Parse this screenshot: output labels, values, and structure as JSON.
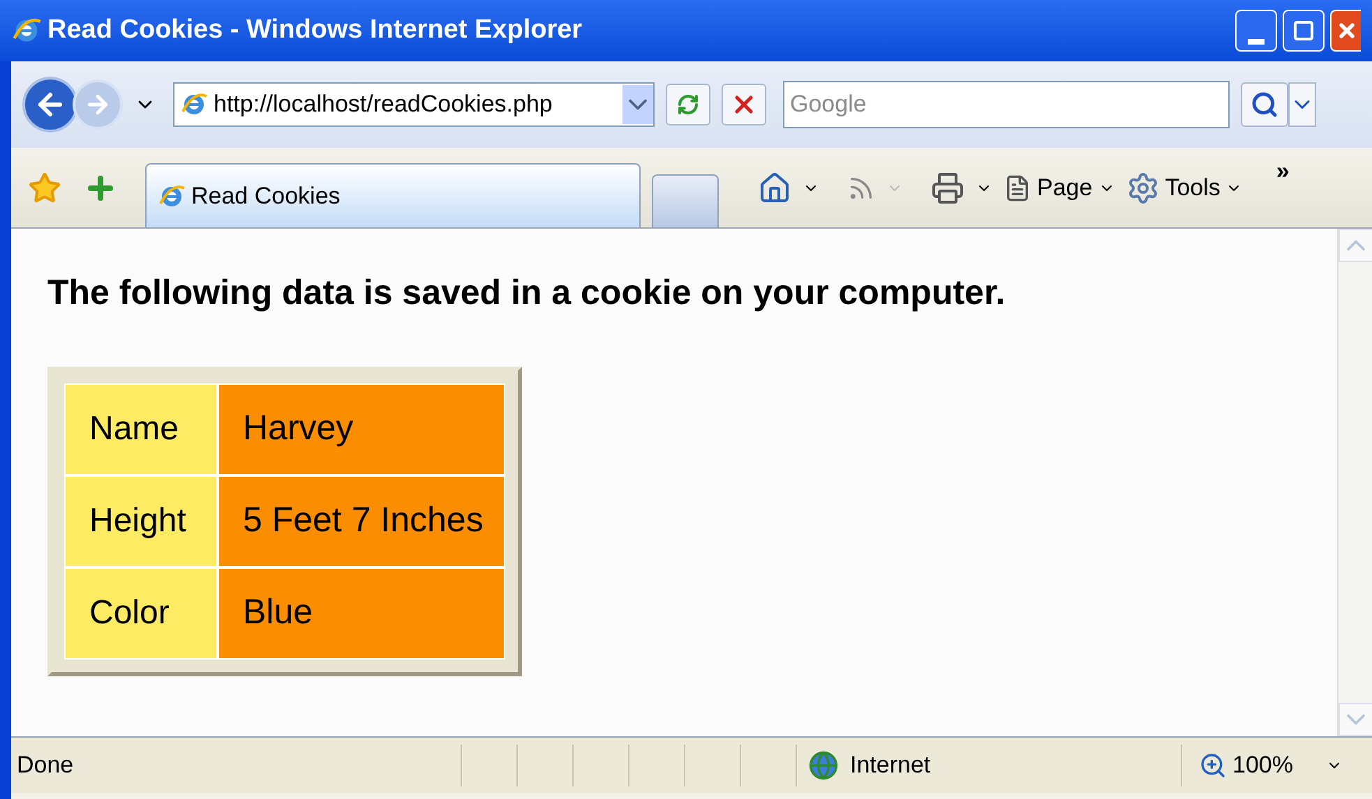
{
  "window": {
    "title": "Read Cookies - Windows Internet Explorer"
  },
  "address_bar": {
    "value": "http://localhost/readCookies.php"
  },
  "search": {
    "placeholder": "Google"
  },
  "tabs": [
    {
      "label": "Read Cookies",
      "selected": true
    }
  ],
  "command_bar": {
    "items": [
      "Page",
      "Tools"
    ],
    "overflow": "»"
  },
  "page": {
    "heading": "The following data is saved in a cookie on your computer.",
    "cookie_table": [
      {
        "label": "Name",
        "value": "Harvey"
      },
      {
        "label": "Height",
        "value": "5 Feet 7 Inches"
      },
      {
        "label": "Color",
        "value": "Blue"
      }
    ]
  },
  "status_bar": {
    "status": "Done",
    "zone": "Internet",
    "zoom": "100%"
  }
}
